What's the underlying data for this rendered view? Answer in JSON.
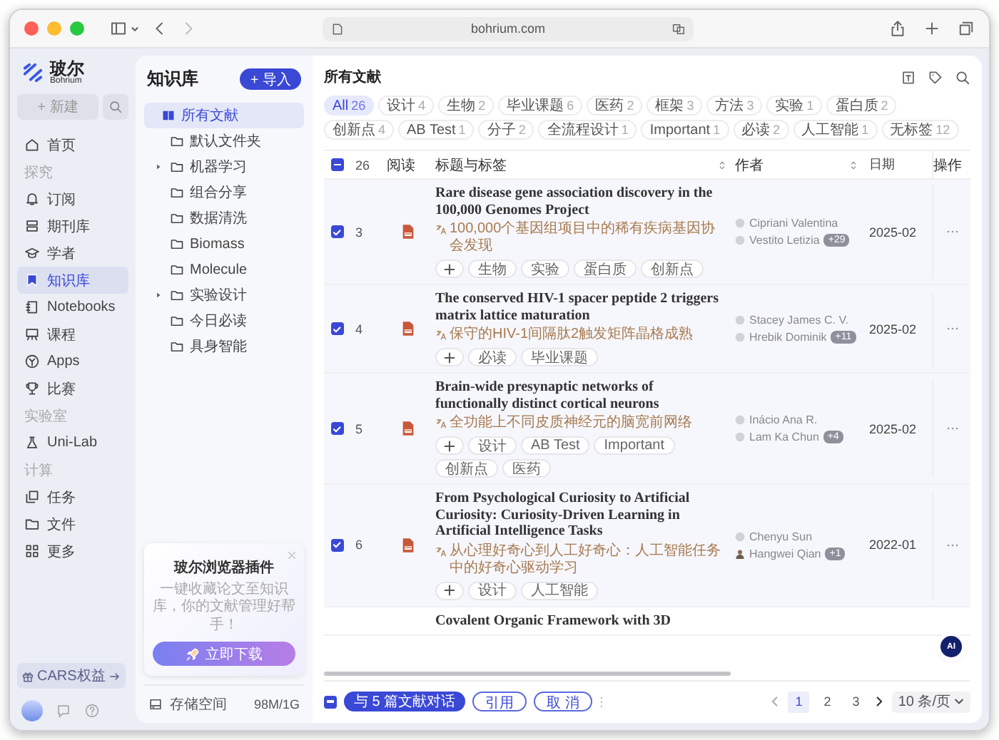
{
  "browser": {
    "url": "bohrium.com"
  },
  "nav": {
    "brand": "玻尔",
    "brand_sub": "Bohrium",
    "new_button": "+ 新建",
    "items": [
      {
        "kind": "link",
        "label": "首页",
        "selected": false
      },
      {
        "kind": "section",
        "label": "探究"
      },
      {
        "kind": "link",
        "label": "订阅",
        "selected": false
      },
      {
        "kind": "link",
        "label": "期刊库",
        "selected": false
      },
      {
        "kind": "link",
        "label": "学者",
        "selected": false
      },
      {
        "kind": "link",
        "label": "知识库",
        "selected": true
      },
      {
        "kind": "link",
        "label": "Notebooks",
        "selected": false
      },
      {
        "kind": "link",
        "label": "课程",
        "selected": false
      },
      {
        "kind": "link",
        "label": "Apps",
        "selected": false
      },
      {
        "kind": "link",
        "label": "比赛",
        "selected": false
      },
      {
        "kind": "section",
        "label": "实验室"
      },
      {
        "kind": "link",
        "label": "Uni-Lab",
        "selected": false
      },
      {
        "kind": "section",
        "label": "计算"
      },
      {
        "kind": "link",
        "label": "任务",
        "selected": false
      },
      {
        "kind": "link",
        "label": "文件",
        "selected": false
      },
      {
        "kind": "link",
        "label": "更多",
        "selected": false
      }
    ],
    "benefit_button": "CARS权益"
  },
  "library": {
    "title": "知识库",
    "import_button": "+ 导入",
    "folders": [
      {
        "label": "所有文献",
        "kind": "all",
        "selected": true,
        "expandable": false
      },
      {
        "label": "默认文件夹",
        "kind": "folder",
        "selected": false,
        "expandable": false
      },
      {
        "label": "机器学习",
        "kind": "folder",
        "selected": false,
        "expandable": true
      },
      {
        "label": "组合分享",
        "kind": "folder",
        "selected": false,
        "expandable": false
      },
      {
        "label": "数据清洗",
        "kind": "folder",
        "selected": false,
        "expandable": false
      },
      {
        "label": "Biomass",
        "kind": "folder",
        "selected": false,
        "expandable": false
      },
      {
        "label": "Molecule",
        "kind": "folder",
        "selected": false,
        "expandable": false
      },
      {
        "label": "实验设计",
        "kind": "folder",
        "selected": false,
        "expandable": true
      },
      {
        "label": "今日必读",
        "kind": "folder",
        "selected": false,
        "expandable": false
      },
      {
        "label": "具身智能",
        "kind": "folder",
        "selected": false,
        "expandable": false
      }
    ],
    "promo": {
      "title": "玻尔浏览器插件",
      "text": "一键收藏论文至知识库，你的文献管理好帮手！",
      "button": "立即下载"
    },
    "storage": {
      "label": "存储空间",
      "value": "98M/1G"
    }
  },
  "main": {
    "title": "所有文献",
    "filters": [
      {
        "label": "All",
        "count": "26",
        "selected": true
      },
      {
        "label": "设计",
        "count": "4",
        "selected": false
      },
      {
        "label": "生物",
        "count": "2",
        "selected": false
      },
      {
        "label": "毕业课题",
        "count": "6",
        "selected": false
      },
      {
        "label": "医药",
        "count": "2",
        "selected": false
      },
      {
        "label": "框架",
        "count": "3",
        "selected": false
      },
      {
        "label": "方法",
        "count": "3",
        "selected": false
      },
      {
        "label": "实验",
        "count": "1",
        "selected": false
      },
      {
        "label": "蛋白质",
        "count": "2",
        "selected": false
      },
      {
        "label": "创新点",
        "count": "4",
        "selected": false
      },
      {
        "label": "AB Test",
        "count": "1",
        "selected": false
      },
      {
        "label": "分子",
        "count": "2",
        "selected": false
      },
      {
        "label": "全流程设计",
        "count": "1",
        "selected": false
      },
      {
        "label": "Important",
        "count": "1",
        "selected": false
      },
      {
        "label": "必读",
        "count": "2",
        "selected": false
      },
      {
        "label": "人工智能",
        "count": "1",
        "selected": false
      },
      {
        "label": "无标签",
        "count": "12",
        "selected": false
      }
    ],
    "table": {
      "select_all_partial": true,
      "count": "26",
      "columns": [
        {
          "label": "阅读",
          "sortable": false
        },
        {
          "label": "标题与标签",
          "sortable": true
        },
        {
          "label": "作者",
          "sortable": true
        },
        {
          "label": "日期",
          "sortable": false
        },
        {
          "label": "操作",
          "sortable": false
        }
      ],
      "rows": [
        {
          "checked": true,
          "index": "3",
          "title": "Rare disease gene association discovery in the 100,000 Genomes Project",
          "translation": "100,000个基因组项目中的稀有疾病基因协会发现",
          "tags": [
            "生物",
            "实验",
            "蛋白质",
            "创新点"
          ],
          "authors": [
            {
              "name": "Cipriani Valentina",
              "photo": false
            },
            {
              "name": "Vestito Letizia",
              "photo": false,
              "more": "+29"
            }
          ],
          "date": "2025-02"
        },
        {
          "checked": true,
          "index": "4",
          "title": "The conserved HIV-1 spacer peptide 2 triggers matrix lattice maturation",
          "translation": "保守的HIV-1间隔肽2触发矩阵晶格成熟",
          "tags": [
            "必读",
            "毕业课题"
          ],
          "authors": [
            {
              "name": "Stacey James C. V.",
              "photo": false
            },
            {
              "name": "Hrebik Dominik",
              "photo": false,
              "more": "+11"
            }
          ],
          "date": "2025-02"
        },
        {
          "checked": true,
          "index": "5",
          "title": "Brain-wide presynaptic networks of functionally distinct cortical neurons",
          "translation": "全功能上不同皮质神经元的脑宽前网络",
          "tags": [
            "设计",
            "AB Test",
            "Important",
            "创新点",
            "医药"
          ],
          "authors": [
            {
              "name": "Inácio Ana R.",
              "photo": false
            },
            {
              "name": "Lam Ka Chun",
              "photo": false,
              "more": "+4"
            }
          ],
          "date": "2025-02"
        },
        {
          "checked": true,
          "index": "6",
          "title": "From Psychological Curiosity to Artificial Curiosity: Curiosity-Driven Learning in Artificial Intelligence Tasks",
          "translation": "从心理好奇心到人工好奇心：人工智能任务中的好奇心驱动学习",
          "tags": [
            "设计",
            "人工智能"
          ],
          "authors": [
            {
              "name": "Chenyu Sun",
              "photo": false
            },
            {
              "name": "Hangwei Qian",
              "photo": true,
              "more": "+1"
            }
          ],
          "date": "2022-01"
        }
      ],
      "cut_row_title": "Covalent Organic Framework with 3D"
    },
    "footer": {
      "select_partial": true,
      "chat_button": "与 5 篇文献对话",
      "cite_button": "引用",
      "cancel_button": "取 消",
      "pages": [
        {
          "label": "1",
          "selected": true
        },
        {
          "label": "2",
          "selected": false
        },
        {
          "label": "3",
          "selected": false
        }
      ],
      "page_size": "10 条/页"
    },
    "ai_button": "AI"
  }
}
